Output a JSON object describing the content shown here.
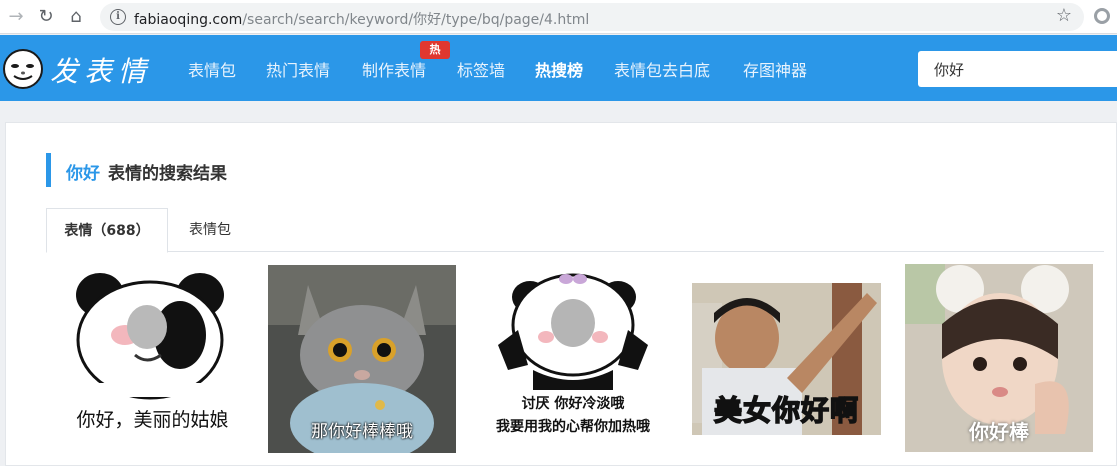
{
  "browser": {
    "url_host": "fabiaoqing.com",
    "url_path": "/search/search/keyword/你好/type/bq/page/4.html"
  },
  "header": {
    "logo_text": "发表情",
    "nav": [
      "表情包",
      "热门表情",
      "制作表情",
      "标签墙",
      "热搜榜",
      "表情包去白底",
      "存图神器"
    ],
    "hot_badge": "热",
    "search_value": "你好"
  },
  "results": {
    "keyword": "你好",
    "title_suffix": "表情的搜索结果",
    "tabs": [
      "表情（688）",
      "表情包"
    ]
  },
  "stickers": [
    {
      "caption": "你好，美丽的姑娘"
    },
    {
      "caption": "那你好棒棒哦"
    },
    {
      "caption_line1": "讨厌 你好冷淡哦",
      "caption_line2": "我要用我的心帮你加热哦"
    },
    {
      "caption": "美女你好啊"
    },
    {
      "caption": "你好棒"
    }
  ],
  "colors": {
    "brand": "#2b97e8",
    "hot": "#e0372f"
  }
}
